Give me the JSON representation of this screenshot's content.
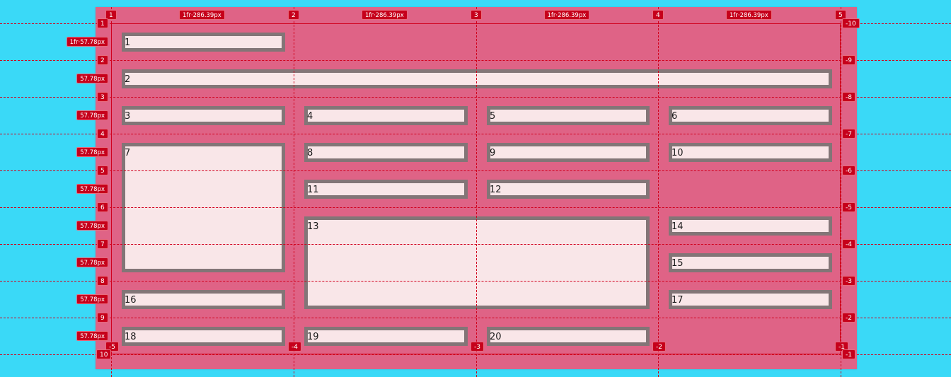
{
  "grid": {
    "column_size_labels": [
      "1fr·286.39px",
      "1fr·286.39px",
      "1fr·286.39px",
      "1fr·286.39px"
    ],
    "row_size_labels": [
      "1fr·57.78px",
      "57.78px",
      "57.78px",
      "57.78px",
      "57.78px",
      "57.78px",
      "57.78px",
      "57.78px",
      "57.78px"
    ],
    "column_line_numbers_top": [
      "1",
      "2",
      "3",
      "4",
      "5"
    ],
    "column_line_numbers_bottom": [
      "-5",
      "-4",
      "-3",
      "-2",
      "-1"
    ],
    "row_line_numbers_left": [
      "1",
      "2",
      "3",
      "4",
      "5",
      "6",
      "7",
      "8",
      "9",
      "10"
    ],
    "row_line_numbers_right": [
      "-10",
      "-9",
      "-8",
      "-7",
      "-6",
      "-5",
      "-4",
      "-3",
      "-2",
      "-1"
    ]
  },
  "items": [
    {
      "label": "1"
    },
    {
      "label": "2"
    },
    {
      "label": "3"
    },
    {
      "label": "4"
    },
    {
      "label": "5"
    },
    {
      "label": "6"
    },
    {
      "label": "7"
    },
    {
      "label": "8"
    },
    {
      "label": "9"
    },
    {
      "label": "10"
    },
    {
      "label": "11"
    },
    {
      "label": "12"
    },
    {
      "label": "13"
    },
    {
      "label": "14"
    },
    {
      "label": "15"
    },
    {
      "label": "16"
    },
    {
      "label": "17"
    },
    {
      "label": "18"
    },
    {
      "label": "19"
    },
    {
      "label": "20"
    }
  ],
  "colors": {
    "page_background": "#3ad9f7",
    "container_background": "#df6386",
    "item_background": "#f9e6e8",
    "item_border": "#837577",
    "overlay_accent": "#c6001b"
  }
}
